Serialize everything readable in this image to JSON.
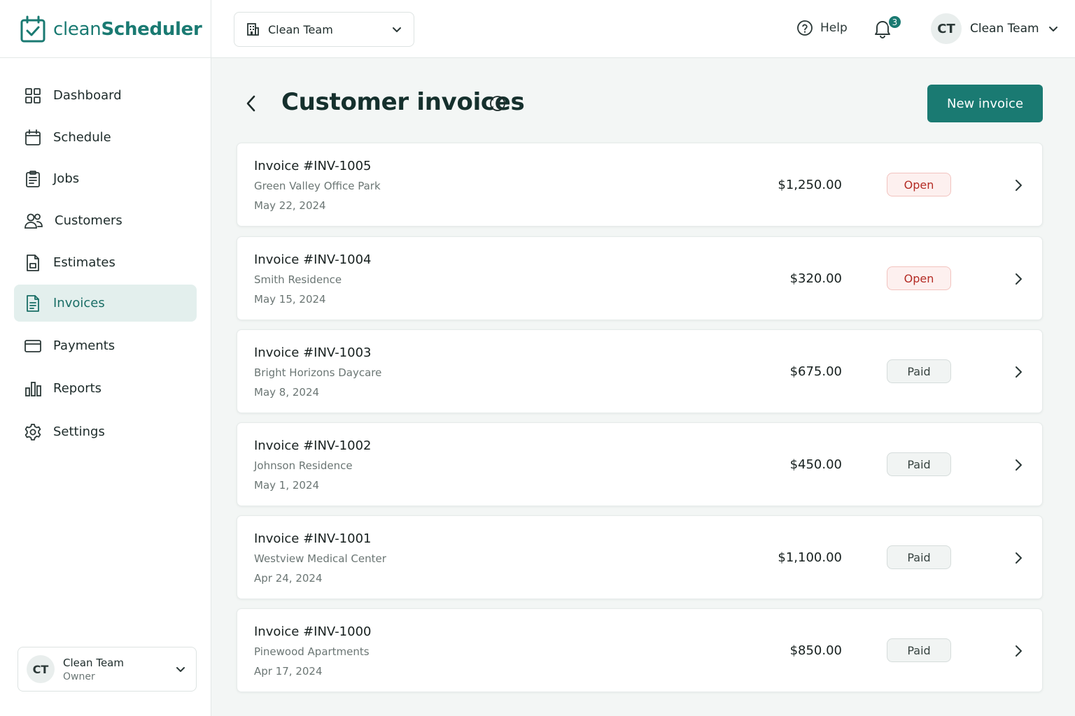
{
  "app": {
    "brand_prefix": "clean",
    "brand_suffix": "Scheduler",
    "accent_color": "#1a7a72"
  },
  "header": {
    "team_select": {
      "value": "Clean Team",
      "icon": "building-icon"
    },
    "help_label": "Help",
    "notifications_count": "3",
    "profile": {
      "initials": "CT",
      "name": "Clean Team"
    }
  },
  "sidebar": {
    "items": [
      {
        "label": "Dashboard",
        "icon": "grid-icon",
        "active": false
      },
      {
        "label": "Schedule",
        "icon": "calendar-icon",
        "active": false
      },
      {
        "label": "Jobs",
        "icon": "clipboard-icon",
        "active": false
      },
      {
        "label": "Customers",
        "icon": "users-icon",
        "active": false
      },
      {
        "label": "Estimates",
        "icon": "document-icon",
        "active": false
      },
      {
        "label": "Invoices",
        "icon": "invoice-icon",
        "active": true
      },
      {
        "label": "Payments",
        "icon": "card-icon",
        "active": false
      },
      {
        "label": "Reports",
        "icon": "bar-chart-icon",
        "active": false
      },
      {
        "label": "Settings",
        "icon": "gear-icon",
        "active": false
      }
    ],
    "user": {
      "initials": "CT",
      "name": "Clean Team",
      "role": "Owner"
    }
  },
  "main": {
    "title": "Customer invoices",
    "new_button_label": "New invoice",
    "invoices": [
      {
        "number": "Invoice #INV-1005",
        "customer": "Green Valley Office Park",
        "date": "May 22, 2024",
        "amount": "$1,250.00",
        "status": "Open"
      },
      {
        "number": "Invoice #INV-1004",
        "customer": "Smith Residence",
        "date": "May 15, 2024",
        "amount": "$320.00",
        "status": "Open"
      },
      {
        "number": "Invoice #INV-1003",
        "customer": "Bright Horizons Daycare",
        "date": "May 8, 2024",
        "amount": "$675.00",
        "status": "Paid"
      },
      {
        "number": "Invoice #INV-1002",
        "customer": "Johnson Residence",
        "date": "May 1, 2024",
        "amount": "$450.00",
        "status": "Paid"
      },
      {
        "number": "Invoice #INV-1001",
        "customer": "Westview Medical Center",
        "date": "Apr 24, 2024",
        "amount": "$1,100.00",
        "status": "Paid"
      },
      {
        "number": "Invoice #INV-1000",
        "customer": "Pinewood Apartments",
        "date": "Apr 17, 2024",
        "amount": "$850.00",
        "status": "Paid"
      }
    ]
  }
}
